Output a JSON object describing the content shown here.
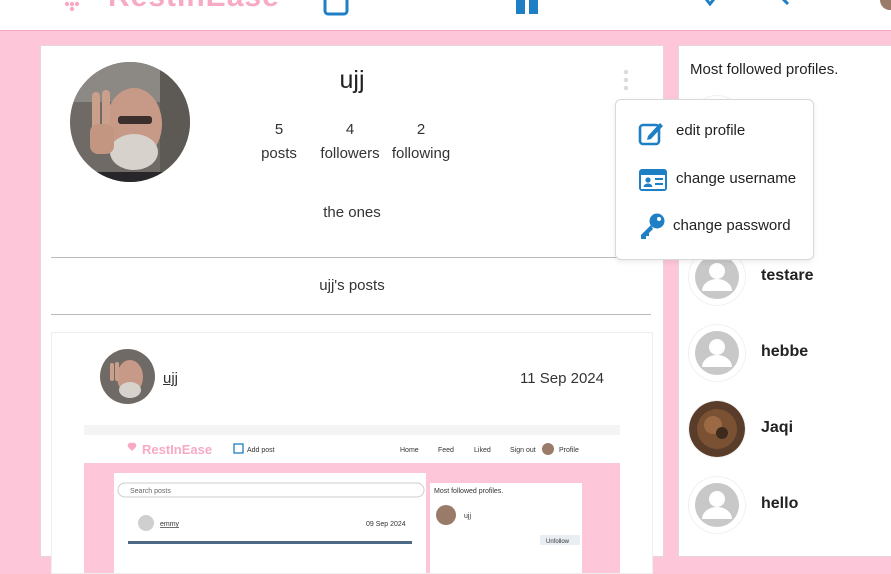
{
  "navbar": {
    "brand": "RestInEase"
  },
  "profile": {
    "username": "ujj",
    "stats": [
      {
        "value": "5",
        "label": "posts"
      },
      {
        "value": "4",
        "label": "followers"
      },
      {
        "value": "2",
        "label": "following"
      }
    ],
    "bio": "the ones",
    "posts_heading": "ujj's posts"
  },
  "menu": {
    "items": [
      {
        "label": "edit profile",
        "icon": "edit-icon"
      },
      {
        "label": "change username",
        "icon": "id-card-icon"
      },
      {
        "label": "change password",
        "icon": "key-icon"
      }
    ]
  },
  "post": {
    "owner": "ujj",
    "date": "11 Sep 2024",
    "screenshot": {
      "brand": "RestInEase",
      "add_post": "Add post",
      "nav": [
        "Home",
        "Feed",
        "Liked",
        "Sign out",
        "Profile"
      ],
      "search_placeholder": "Search posts",
      "post_owner": "emmy",
      "post_date": "09 Sep 2024",
      "side_title": "Most followed profiles.",
      "side_user": "ujj",
      "unfollow": "Unfollow"
    }
  },
  "sidebar": {
    "title": "Most followed profiles.",
    "profiles": [
      {
        "name": "testare"
      },
      {
        "name": "hebbe"
      },
      {
        "name": "Jaqi"
      },
      {
        "name": "hello"
      }
    ]
  },
  "colors": {
    "background": "#fdc7d9",
    "brand_pink": "#f7a9c6",
    "icon_blue": "#1f7fc4",
    "card": "#ffffff"
  }
}
